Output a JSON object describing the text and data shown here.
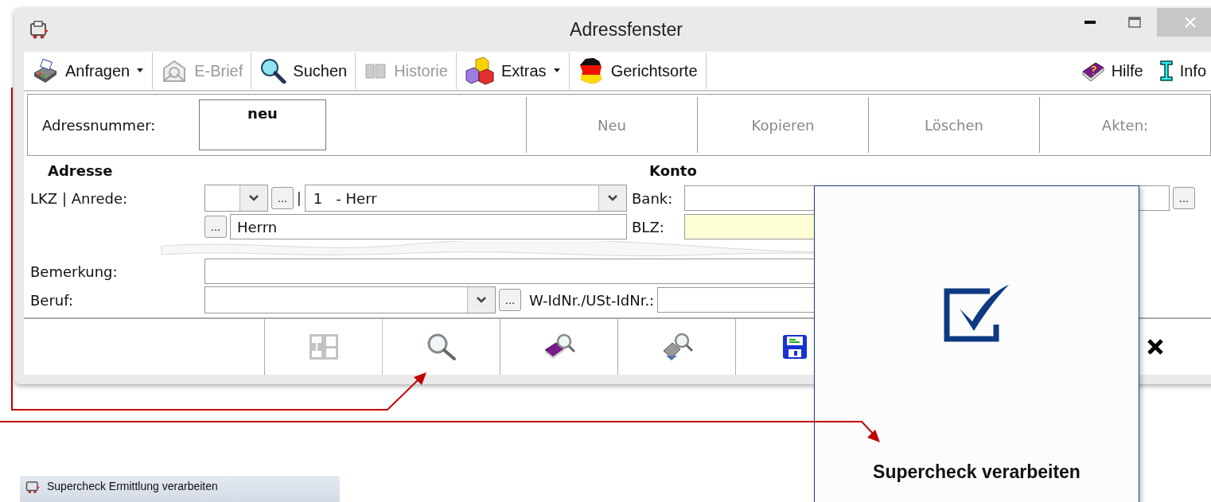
{
  "window": {
    "title": "Adressfenster"
  },
  "toolbar": [
    {
      "label": "Anfragen",
      "dropdown": true,
      "disabled": false
    },
    {
      "label": "E-Brief",
      "dropdown": false,
      "disabled": true
    },
    {
      "label": "Suchen",
      "dropdown": false,
      "disabled": false
    },
    {
      "label": "Historie",
      "dropdown": false,
      "disabled": true
    },
    {
      "label": "Extras",
      "dropdown": true,
      "disabled": false
    },
    {
      "label": "Gerichtsorte",
      "dropdown": false,
      "disabled": false
    }
  ],
  "toolbar_right": [
    {
      "label": "Hilfe"
    },
    {
      "label": "Info"
    }
  ],
  "address_number": {
    "label": "Adressnummer:",
    "value": "neu"
  },
  "record_buttons": [
    {
      "label": "Neu",
      "disabled": true
    },
    {
      "label": "Kopieren",
      "disabled": true
    },
    {
      "label": "Löschen",
      "disabled": true
    },
    {
      "label": "Akten:",
      "disabled": true
    }
  ],
  "address": {
    "heading": "Adresse",
    "lkz_label": "LKZ | Anrede:",
    "lkz_browse": "...",
    "separator": "|",
    "salutation": "1   - Herr",
    "line_browse": "...",
    "line_value": "Herrn"
  },
  "account": {
    "heading": "Konto",
    "bank_label": "Bank:",
    "bank_browse": "...",
    "blz_label": "BLZ:"
  },
  "remark": {
    "label": "Bemerkung:"
  },
  "occupation": {
    "label": "Beruf:",
    "browse": "...",
    "vat_label": "W-IdNr./USt-IdNr.:"
  },
  "actions": [
    {
      "disabled": true
    },
    {
      "disabled": false
    },
    {
      "disabled": false
    },
    {
      "disabled": false
    },
    {
      "disabled": false
    },
    {
      "disabled": false
    }
  ],
  "card": {
    "caption": "Supercheck verarbeiten"
  },
  "mini_window": {
    "title": "Supercheck Ermittlung verarbeiten"
  }
}
